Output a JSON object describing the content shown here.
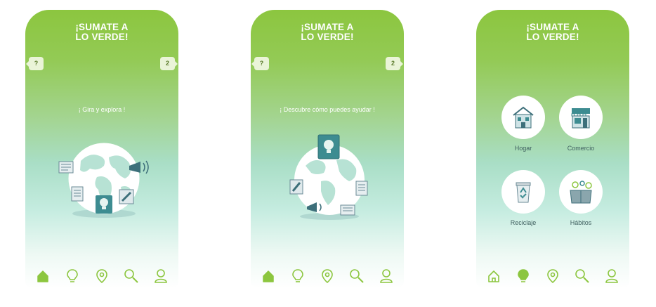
{
  "colors": {
    "brand_green": "#8cc63f",
    "teal_accent": "#3d8c91",
    "nav_green": "#8cc63f"
  },
  "screens": [
    {
      "brand_line1": "¡SUMATE A",
      "brand_line2": "LO VERDE!",
      "left_button": "?",
      "right_button": "2",
      "prompt": "¡ Gira y explora !",
      "active_nav": "home-icon"
    },
    {
      "brand_line1": "¡SUMATE A",
      "brand_line2": "LO VERDE!",
      "left_button": "?",
      "right_button": "2",
      "prompt": "¡ Descubre cómo puedes ayudar !",
      "active_nav": "home-icon"
    },
    {
      "brand_line1": "¡SUMATE A",
      "brand_line2": "LO VERDE!",
      "active_nav": "lightbulb-icon",
      "categories": [
        {
          "label": "Hogar",
          "icon": "house-icon"
        },
        {
          "label": "Comercio",
          "icon": "store-icon"
        },
        {
          "label": "Reciclaje",
          "icon": "recycle-bin-icon"
        },
        {
          "label": "Hábitos",
          "icon": "habits-box-icon"
        }
      ]
    }
  ],
  "nav_items": [
    "home-icon",
    "lightbulb-icon",
    "location-pin-icon",
    "search-icon",
    "user-icon"
  ]
}
